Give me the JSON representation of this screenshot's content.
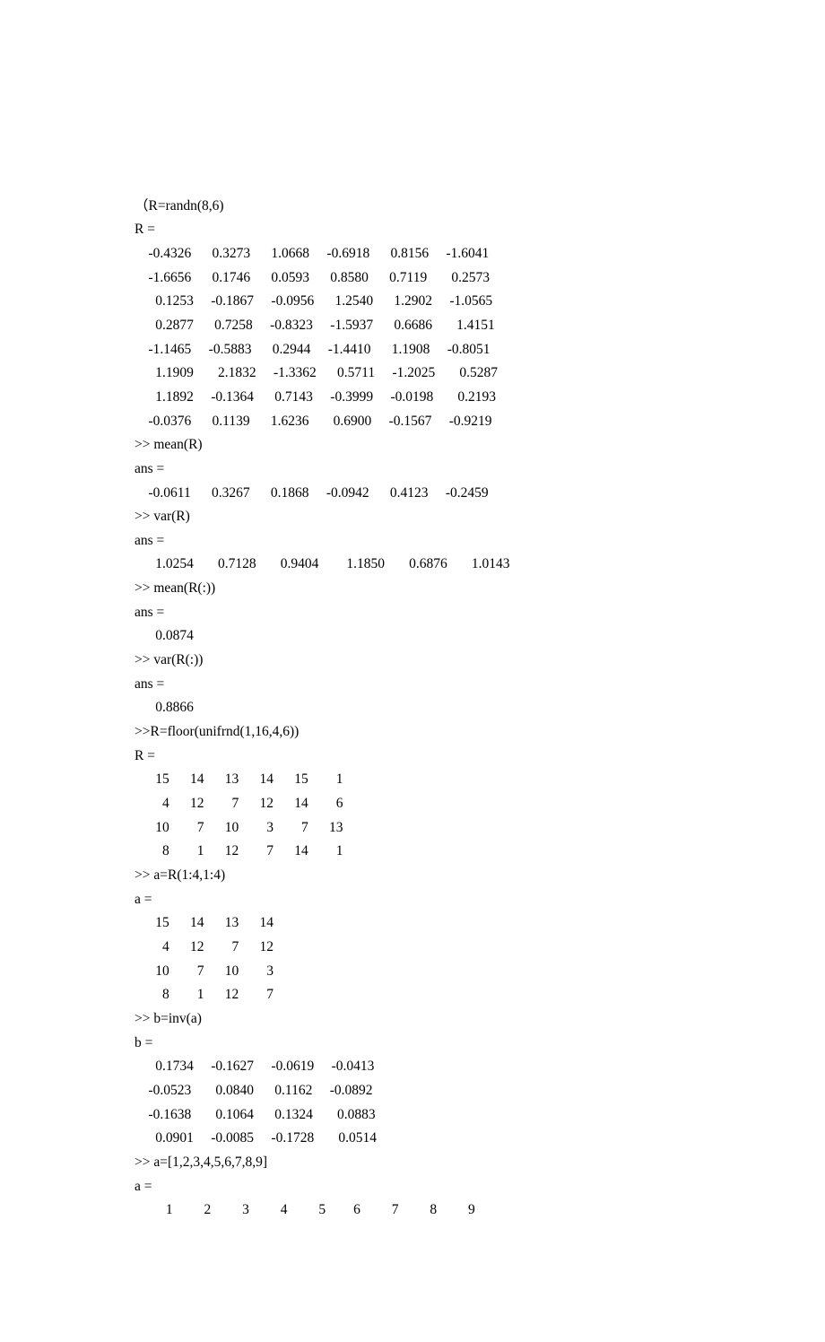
{
  "lines": [
    "（R=randn(8,6)",
    "R =",
    "    -0.4326      0.3273      1.0668     -0.6918      0.8156     -1.6041",
    "    -1.6656      0.1746      0.0593      0.8580      0.7119       0.2573",
    "      0.1253     -0.1867     -0.0956      1.2540      1.2902     -1.0565",
    "      0.2877      0.7258     -0.8323     -1.5937      0.6686       1.4151",
    "    -1.1465     -0.5883      0.2944     -1.4410      1.1908     -0.8051",
    "      1.1909       2.1832     -1.3362      0.5711     -1.2025       0.5287",
    "      1.1892     -0.1364      0.7143     -0.3999     -0.0198       0.2193",
    "    -0.0376      0.1139      1.6236       0.6900     -0.1567     -0.9219",
    ">> mean(R)",
    "ans =",
    "    -0.0611      0.3267      0.1868     -0.0942      0.4123     -0.2459",
    ">> var(R)",
    "ans =",
    "      1.0254       0.7128       0.9404        1.1850       0.6876       1.0143",
    ">> mean(R(:))",
    "ans =",
    "      0.0874",
    ">> var(R(:))",
    "ans =",
    "      0.8866",
    ">>R=floor(unifrnd(1,16,4,6))",
    "R =",
    "      15      14      13      14      15        1",
    "        4      12        7      12      14        6",
    "      10        7      10        3        7      13",
    "        8        1      12        7      14        1",
    ">> a=R(1:4,1:4)",
    "a =",
    "      15      14      13      14",
    "        4      12        7      12",
    "      10        7      10        3",
    "        8        1      12        7",
    ">> b=inv(a)",
    "b =",
    "      0.1734     -0.1627     -0.0619     -0.0413",
    "    -0.0523       0.0840      0.1162     -0.0892",
    "    -0.1638       0.1064      0.1324       0.0883",
    "      0.0901     -0.0085     -0.1728       0.0514",
    ">> a=[1,2,3,4,5,6,7,8,9]",
    "a =",
    "         1         2         3         4         5        6         7         8         9"
  ]
}
